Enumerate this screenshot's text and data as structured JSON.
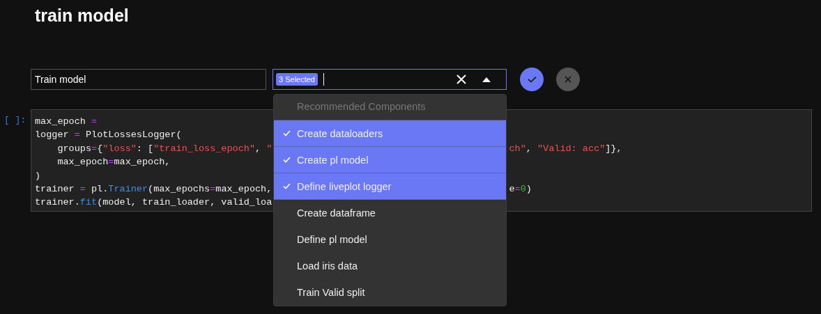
{
  "title": "train model",
  "name_field": {
    "value": "Train model"
  },
  "multiselect": {
    "badge": "3 Selected",
    "open": true
  },
  "dropdown": {
    "header": "Recommended Components",
    "options": [
      {
        "label": "Create dataloaders",
        "selected": true
      },
      {
        "label": "Create pl model",
        "selected": true
      },
      {
        "label": "Define liveplot logger",
        "selected": true
      },
      {
        "label": "Create dataframe",
        "selected": false
      },
      {
        "label": "Define pl model",
        "selected": false
      },
      {
        "label": "Load iris data",
        "selected": false
      },
      {
        "label": "Train Valid split",
        "selected": false
      }
    ]
  },
  "cell": {
    "prompt": "[ ]:",
    "lines": [
      {
        "left": [
          {
            "text": "max_epoch ",
            "kind": "plain"
          },
          {
            "text": "=",
            "kind": "op"
          }
        ]
      },
      {
        "left": [
          {
            "text": "logger ",
            "kind": "plain"
          },
          {
            "text": "=",
            "kind": "op"
          },
          {
            "text": " PlotLossesLogger(",
            "kind": "plain"
          }
        ]
      },
      {
        "left": [
          {
            "text": "    groups",
            "kind": "plain"
          },
          {
            "text": "=",
            "kind": "op"
          },
          {
            "text": "{",
            "kind": "plain"
          },
          {
            "text": "\"loss\"",
            "kind": "str"
          },
          {
            "text": ": [",
            "kind": "plain"
          },
          {
            "text": "\"train_loss_epoch\"",
            "kind": "str"
          },
          {
            "text": ", ",
            "kind": "plain"
          },
          {
            "text": "\"",
            "kind": "str"
          }
        ],
        "right": [
          {
            "text": "ch\"",
            "kind": "str"
          },
          {
            "text": ", ",
            "kind": "plain"
          },
          {
            "text": "\"Valid: acc\"",
            "kind": "str"
          },
          {
            "text": "]},",
            "kind": "plain"
          }
        ]
      },
      {
        "left": [
          {
            "text": "    max_epoch",
            "kind": "plain"
          },
          {
            "text": "=",
            "kind": "op"
          },
          {
            "text": "max_epoch,",
            "kind": "plain"
          }
        ]
      },
      {
        "left": [
          {
            "text": ")",
            "kind": "plain"
          }
        ]
      },
      {
        "left": [
          {
            "text": "trainer ",
            "kind": "plain"
          },
          {
            "text": "=",
            "kind": "op"
          },
          {
            "text": " pl.",
            "kind": "plain"
          },
          {
            "text": "Trainer",
            "kind": "fn"
          },
          {
            "text": "(max_epochs",
            "kind": "plain"
          },
          {
            "text": "=",
            "kind": "op"
          },
          {
            "text": "max_epoch,",
            "kind": "plain"
          }
        ],
        "right": [
          {
            "text": "e",
            "kind": "plain"
          },
          {
            "text": "=",
            "kind": "op"
          },
          {
            "text": "0",
            "kind": "num"
          },
          {
            "text": ")",
            "kind": "plain"
          }
        ]
      },
      {
        "left": [
          {
            "text": "trainer.",
            "kind": "plain"
          },
          {
            "text": "fit",
            "kind": "fn"
          },
          {
            "text": "(model, train_loader, valid_loa",
            "kind": "plain"
          }
        ]
      }
    ]
  }
}
